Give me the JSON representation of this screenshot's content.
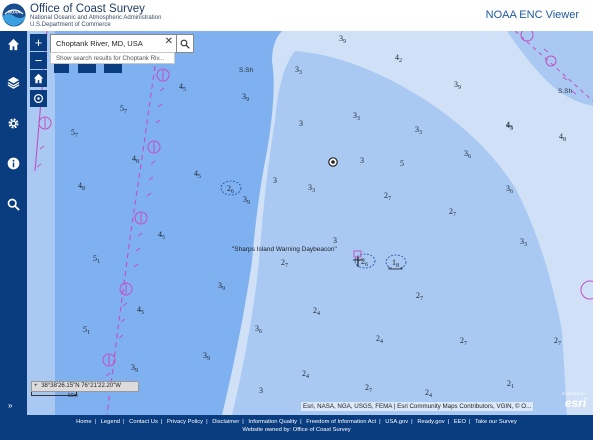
{
  "header": {
    "agency_title": "Office of Coast Survey",
    "agency_line1": "National Oceanic and Atmospheric Administration",
    "agency_line2": "U.S.Department of Commerce",
    "logo_text": "NOAA",
    "app_title": "NOAA ENC Viewer"
  },
  "sidebar": {
    "items": [
      {
        "name": "home-icon"
      },
      {
        "name": "layers-icon"
      },
      {
        "name": "gear-icon"
      },
      {
        "name": "info-icon"
      },
      {
        "name": "search-icon"
      }
    ],
    "expand_label": "»"
  },
  "map": {
    "zoom_in": "+",
    "zoom_out": "−",
    "search": {
      "value": "Choptank River, MD, USA",
      "clear": "✕",
      "suggestion": "Show search results for Choptank Riv..."
    },
    "daybeacon_label": "\"Sharps Island Warning Daybeacon\"",
    "land_labels": [
      "S.Sh",
      "S.Sh"
    ],
    "soundings": [
      {
        "n": "3",
        "d": "9"
      },
      {
        "n": "4",
        "d": "2"
      },
      {
        "n": "3",
        "d": "3"
      },
      {
        "n": "3",
        "d": "9"
      },
      {
        "n": "4",
        "d": "5"
      },
      {
        "n": "4",
        "d": "5"
      },
      {
        "n": "3",
        "d": "9"
      },
      {
        "n": "5",
        "d": "7"
      },
      {
        "n": "3",
        "d": ""
      },
      {
        "n": "3",
        "d": "3"
      },
      {
        "n": "3",
        "d": "3"
      },
      {
        "n": "4",
        "d": "5"
      },
      {
        "n": "4",
        "d": "8"
      },
      {
        "n": "5",
        "d": "7"
      },
      {
        "n": "3",
        "d": "6"
      },
      {
        "n": "4",
        "d": "8"
      },
      {
        "n": "3",
        "d": ""
      },
      {
        "n": "5",
        "d": ""
      },
      {
        "n": "4",
        "d": "5"
      },
      {
        "n": "3",
        "d": ""
      },
      {
        "n": "3",
        "d": "3"
      },
      {
        "n": "2",
        "d": "6"
      },
      {
        "n": "3",
        "d": "9"
      },
      {
        "n": "2",
        "d": "7"
      },
      {
        "n": "3",
        "d": "6"
      },
      {
        "n": "4",
        "d": "8"
      },
      {
        "n": "2",
        "d": "7"
      },
      {
        "n": "4",
        "d": "5"
      },
      {
        "n": "3",
        "d": ""
      },
      {
        "n": "3",
        "d": "3"
      },
      {
        "n": "5",
        "d": "1"
      },
      {
        "n": "2",
        "d": "7"
      },
      {
        "n": "2",
        "d": "6"
      },
      {
        "n": "1",
        "d": "8"
      },
      {
        "n": "3",
        "d": "9"
      },
      {
        "n": "2",
        "d": "7"
      },
      {
        "n": "4",
        "d": "5"
      },
      {
        "n": "2",
        "d": "4"
      },
      {
        "n": "5",
        "d": "1"
      },
      {
        "n": "3",
        "d": "6"
      },
      {
        "n": "2",
        "d": "4"
      },
      {
        "n": "2",
        "d": "7"
      },
      {
        "n": "2",
        "d": "7"
      },
      {
        "n": "3",
        "d": "9"
      },
      {
        "n": "3",
        "d": "9"
      },
      {
        "n": "2",
        "d": "4"
      },
      {
        "n": "2",
        "d": "7"
      },
      {
        "n": "2",
        "d": "4"
      },
      {
        "n": "2",
        "d": "1"
      },
      {
        "n": "3",
        "d": ""
      }
    ],
    "coordinates": "38°38'26.15\"N 76°21'22.20\"W",
    "scale_label": "50m",
    "attribution": "Esri, NASA, NGA, USGS, FEMA | Esri Community Maps Contributors, VGIN, © O...",
    "esri_powered": "POWERED BY",
    "esri_logo": "esri",
    "colors": {
      "deep_water": "#cfe0f7",
      "mid_water": "#a9c8f2",
      "shallow_water": "#7fb0ef",
      "channel_magenta": "#c44fc4",
      "nav_blue": "#0a3d80"
    }
  },
  "footer": {
    "links": [
      "Home",
      "Legend",
      "Contact Us",
      "Privacy Policy",
      "Disclaimer",
      "Information Quality",
      "Freedom of Information Act",
      "USA.gov",
      "Ready.gov",
      "EEO",
      "Take our Survey"
    ],
    "owner": "Website owned by: Office of Coast Survey"
  }
}
